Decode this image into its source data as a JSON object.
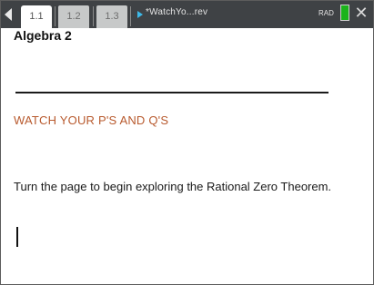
{
  "tabs": [
    {
      "label": "1.1",
      "active": true
    },
    {
      "label": "1.2",
      "active": false
    },
    {
      "label": "1.3",
      "active": false
    }
  ],
  "document": {
    "title": "*WatchYo...rev",
    "mode": "RAD"
  },
  "icons": {
    "left": "chevron-left-icon",
    "doc": "triangle-right-icon",
    "battery": "battery-icon",
    "close": "close-icon"
  },
  "page": {
    "heading": "Algebra 2",
    "subtitle": "WATCH YOUR P'S AND Q'S",
    "body": "Turn the page to begin exploring the Rational Zero Theorem."
  },
  "colors": {
    "tabbar": "#3f4245",
    "subtitle": "#b85a2e",
    "battery": "#1bb31b",
    "doc_arrow": "#3db9e8"
  }
}
